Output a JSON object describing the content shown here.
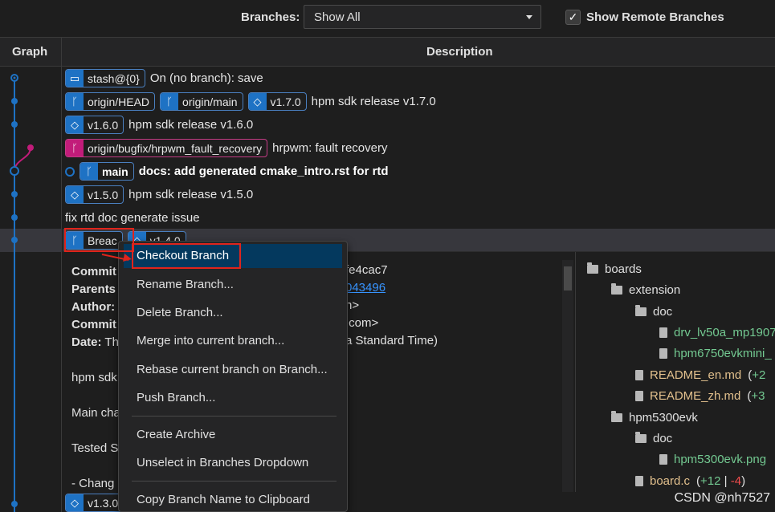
{
  "toolbar": {
    "branches_label": "Branches:",
    "branches_value": "Show All",
    "show_remote_label": "Show Remote Branches",
    "show_remote_checked": true
  },
  "columns": {
    "graph": "Graph",
    "description": "Description"
  },
  "commits": [
    {
      "refs": [
        {
          "type": "stash",
          "label": "stash@{0}"
        }
      ],
      "message": "On (no branch): save"
    },
    {
      "refs": [
        {
          "type": "remote",
          "label": "origin/HEAD"
        },
        {
          "type": "remote",
          "label": "origin/main"
        },
        {
          "type": "tag",
          "label": "v1.7.0"
        }
      ],
      "message": "hpm sdk release v1.7.0"
    },
    {
      "refs": [
        {
          "type": "tag",
          "label": "v1.6.0"
        }
      ],
      "message": "hpm sdk release v1.6.0"
    },
    {
      "refs": [
        {
          "type": "remote-pink",
          "label": "origin/bugfix/hrpwm_fault_recovery"
        }
      ],
      "message": "hrpwm: fault recovery"
    },
    {
      "refs": [
        {
          "type": "head",
          "label": "main"
        }
      ],
      "message": "docs: add generated cmake_intro.rst for rtd"
    },
    {
      "refs": [
        {
          "type": "tag",
          "label": "v1.5.0"
        }
      ],
      "message": "hpm sdk release v1.5.0"
    },
    {
      "refs": [],
      "message": "fix rtd doc generate issue"
    },
    {
      "refs": [
        {
          "type": "branch",
          "label": "Breac"
        },
        {
          "type": "tag",
          "label": "v1.4.0"
        }
      ],
      "message": ""
    }
  ],
  "details": {
    "commit_key": "Commit",
    "commit_tail": "fe4cac7",
    "parents_key": "Parents",
    "parents_tail": "043496",
    "author_key": "Author:",
    "author_tail": "n>",
    "committer_key": "Commit",
    "committer_tail": ".com>",
    "date_key": "Date:",
    "date_head": "Th",
    "date_tail": "a Standard Time)",
    "body_1": "hpm sdk",
    "body_2": "Main cha",
    "body_3": "Tested S",
    "body_4": "- Chang"
  },
  "files": [
    {
      "kind": "folder",
      "name": "boards",
      "indent": 0
    },
    {
      "kind": "folder",
      "name": "extension",
      "indent": 1
    },
    {
      "kind": "folder",
      "name": "doc",
      "indent": 2
    },
    {
      "kind": "file",
      "name": "drv_lv50a_mp1907",
      "indent": 3,
      "status": "added",
      "delta": ""
    },
    {
      "kind": "file",
      "name": "hpm6750evkmini_",
      "indent": 3,
      "status": "added",
      "delta": ""
    },
    {
      "kind": "file",
      "name": "README_en.md",
      "indent": 2,
      "status": "mod",
      "delta_plus": "+2",
      "delta_minus": ""
    },
    {
      "kind": "file",
      "name": "README_zh.md",
      "indent": 2,
      "status": "mod",
      "delta_plus": "+3",
      "delta_minus": ""
    },
    {
      "kind": "folder",
      "name": "hpm5300evk",
      "indent": 1
    },
    {
      "kind": "folder",
      "name": "doc",
      "indent": 2
    },
    {
      "kind": "file",
      "name": "hpm5300evk.png",
      "indent": 3,
      "status": "added",
      "delta": ""
    },
    {
      "kind": "file",
      "name": "board.c",
      "indent": 2,
      "status": "mod",
      "delta_plus": "+12",
      "delta_minus": "-4"
    }
  ],
  "bottom_row": {
    "tag": "v1.3.0"
  },
  "context_menu": {
    "items": [
      "Checkout Branch",
      "Rename Branch...",
      "Delete Branch...",
      "Merge into current branch...",
      "Rebase current branch on Branch...",
      "Push Branch...",
      "Create Archive",
      "Unselect in Branches Dropdown",
      "Copy Branch Name to Clipboard"
    ]
  },
  "watermark": "CSDN @nh7527",
  "colors": {
    "accent": "#1e72c4",
    "pink": "#c21c7a",
    "highlight": "#04395e",
    "annotation": "#e0241b"
  }
}
